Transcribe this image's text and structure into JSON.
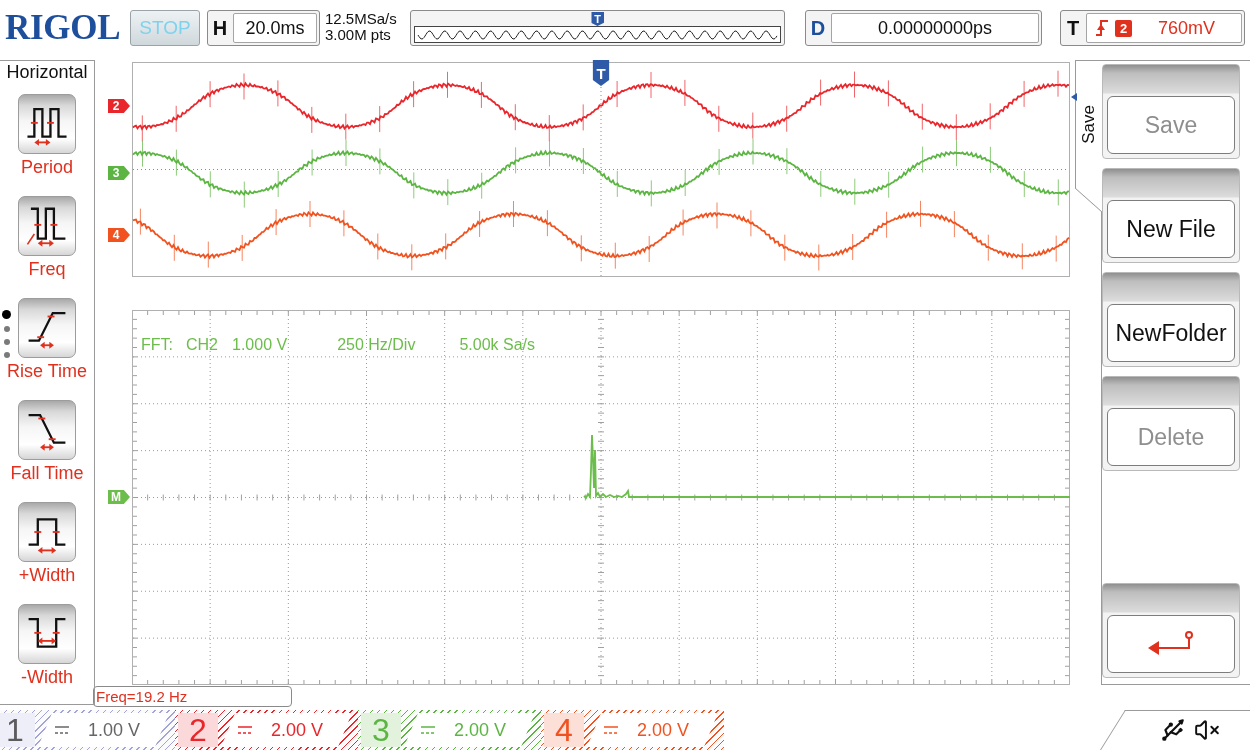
{
  "header": {
    "logo": "RIGOL",
    "run_state": "STOP",
    "timebase": {
      "label": "H",
      "value": "20.0ms"
    },
    "sample_rate": "12.5MSa/s",
    "memory_depth": "3.00M pts",
    "overview": {
      "trigger_marker": "T"
    },
    "delay": {
      "label": "D",
      "value": "0.00000000ps"
    },
    "trigger": {
      "label": "T",
      "channel": "2",
      "level": "760mV"
    }
  },
  "measure_menu": {
    "title": "Horizontal",
    "items": [
      {
        "kind": "period",
        "label": "Period"
      },
      {
        "kind": "freq",
        "label": "Freq"
      },
      {
        "kind": "rise_time",
        "label": "Rise Time"
      },
      {
        "kind": "fall_time",
        "label": "Fall Time"
      },
      {
        "kind": "positive_width",
        "label": "+Width"
      },
      {
        "kind": "negative_width",
        "label": "-Width"
      }
    ],
    "pages": [
      {
        "selected": true
      },
      {
        "selected": false
      },
      {
        "selected": false
      },
      {
        "selected": false
      }
    ]
  },
  "waveform_view": {
    "trigger_marker": "T",
    "traces": [
      {
        "marker": "2",
        "color": "#e8262b"
      },
      {
        "marker": "3",
        "color": "#5cb543"
      },
      {
        "marker": "4",
        "color": "#f0531f"
      }
    ]
  },
  "fft_view": {
    "marker": "M",
    "color": "#6cbd4b",
    "label": "FFT:",
    "source": "CH2",
    "scale": "1.000 V",
    "span": "250 Hz/Div",
    "sample_rate": "5.00k Sa/s"
  },
  "measurement": "Freq=19.2 Hz",
  "save_menu": {
    "tab": "Save",
    "buttons": [
      {
        "kind": "text",
        "label": "Save",
        "disabled": true
      },
      {
        "kind": "text",
        "label": "New File",
        "disabled": false
      },
      {
        "kind": "text",
        "label": "NewFolder",
        "disabled": false
      },
      {
        "kind": "text",
        "label": "Delete",
        "disabled": true
      },
      {
        "kind": "return",
        "disabled": false
      }
    ]
  },
  "channels": [
    {
      "number": "1",
      "scale": "1.00 V",
      "color": "#a3a3dc",
      "on": false
    },
    {
      "number": "2",
      "scale": "2.00 V",
      "color": "#e8262b",
      "on": true
    },
    {
      "number": "3",
      "scale": "2.00 V",
      "color": "#5cb543",
      "on": true
    },
    {
      "number": "4",
      "scale": "2.00 V",
      "color": "#f0531f",
      "on": true
    }
  ]
}
